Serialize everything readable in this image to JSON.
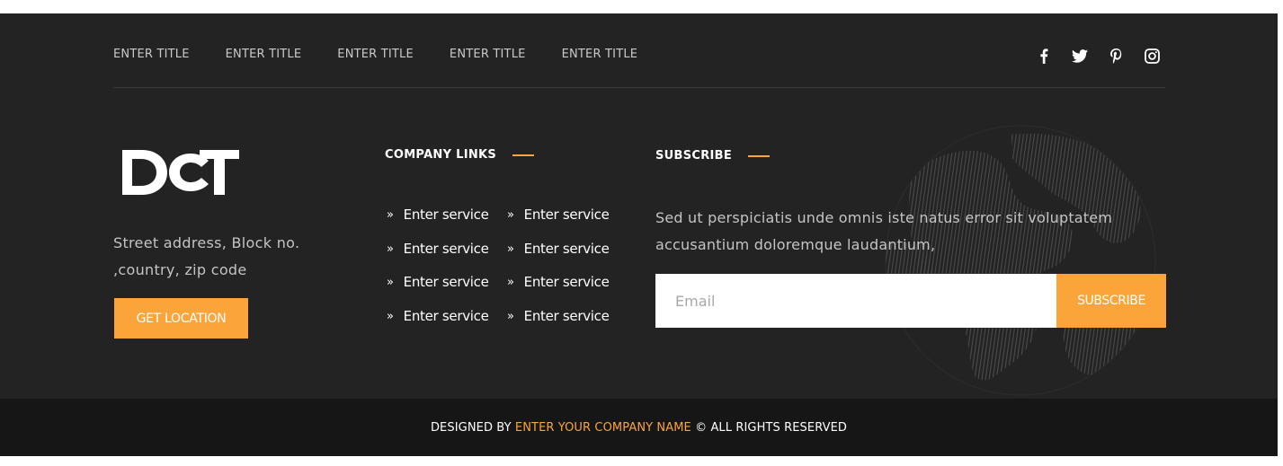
{
  "nav": {
    "items": [
      {
        "label": "ENTER TITLE"
      },
      {
        "label": "ENTER TITLE"
      },
      {
        "label": "ENTER TITLE"
      },
      {
        "label": "ENTER TITLE"
      },
      {
        "label": "ENTER TITLE"
      }
    ]
  },
  "social": {
    "icons": [
      "facebook-icon",
      "twitter-icon",
      "pinterest-icon",
      "instagram-icon"
    ]
  },
  "brand": {
    "logo_text": "DCT",
    "address_line1": "Street address, Block no.",
    "address_line2": ",country, zip code",
    "location_button": "GET LOCATION"
  },
  "company_links": {
    "title": "COMPANY LINKS",
    "items": [
      "Enter service",
      "Enter service",
      "Enter service",
      "Enter service",
      "Enter service",
      "Enter service",
      "Enter service",
      "Enter service"
    ]
  },
  "subscribe": {
    "title": "SUBSCRIBE",
    "text": "Sed ut perspiciatis unde omnis iste natus error sit voluptatem accusantium doloremque laudantium,",
    "email_placeholder": "Email",
    "email_value": "",
    "button_label": "SUBSCRIBE"
  },
  "bottom": {
    "prefix": "DESIGNED BY ",
    "company": "ENTER YOUR COMPANY NAME",
    "suffix": " © ALL RIGHTS RESERVED"
  },
  "colors": {
    "accent": "#fba43a",
    "footer_bg": "#232323",
    "bottom_bg": "#161616"
  }
}
